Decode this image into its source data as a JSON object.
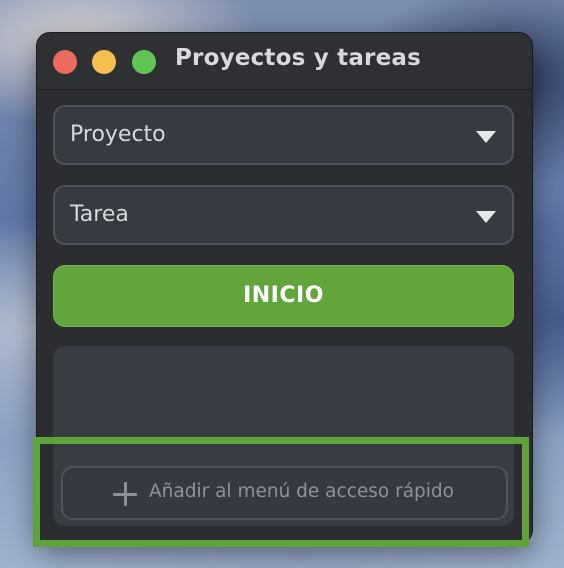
{
  "window": {
    "title": "Proyectos y tareas"
  },
  "form": {
    "project_select": {
      "selected": "Proyecto"
    },
    "task_select": {
      "selected": "Tarea"
    },
    "start_label": "INICIO"
  },
  "quick_access": {
    "add_label": "Añadir al menú de acceso rápido"
  },
  "colors": {
    "accent": "#62a53a",
    "highlight": "#5fa33a"
  },
  "icons": [
    "close-icon",
    "minimize-icon",
    "zoom-icon",
    "chevron-down-icon",
    "plus-icon"
  ]
}
